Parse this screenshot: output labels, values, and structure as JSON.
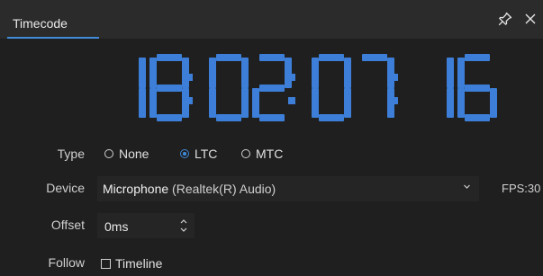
{
  "window": {
    "tab_title": "Timecode",
    "pin_icon": "pin-icon",
    "close_icon": "close-icon"
  },
  "timecode": {
    "display": "18:02:07:16",
    "color": "#3d7fd8"
  },
  "type": {
    "label": "Type",
    "options": [
      {
        "label": "None",
        "selected": false
      },
      {
        "label": "LTC",
        "selected": true
      },
      {
        "label": "MTC",
        "selected": false
      }
    ]
  },
  "device": {
    "label": "Device",
    "value_main": "Microphone",
    "value_sub": " (Realtek(R) Audio)",
    "fps_text": "FPS:30"
  },
  "offset": {
    "label": "Offset",
    "value": "0ms"
  },
  "follow": {
    "label": "Follow",
    "checkbox_label": "Timeline",
    "checked": false
  }
}
